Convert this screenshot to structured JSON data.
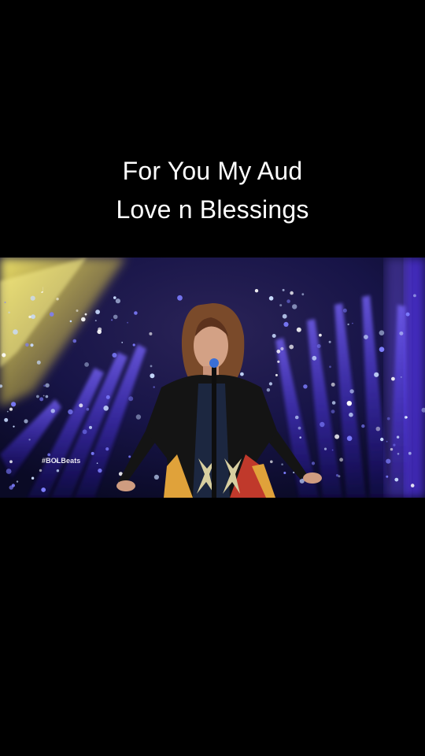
{
  "caption": {
    "line1": "For You My Aud",
    "line2": "Love n Blessings"
  },
  "video": {
    "watermark": "#BOLBeats",
    "colors": {
      "background": "#000000",
      "stage": "#1a1260",
      "spotlight": "#e6d23a",
      "beams": "#5b3dff",
      "sparkle": "#b9d2ff"
    }
  }
}
